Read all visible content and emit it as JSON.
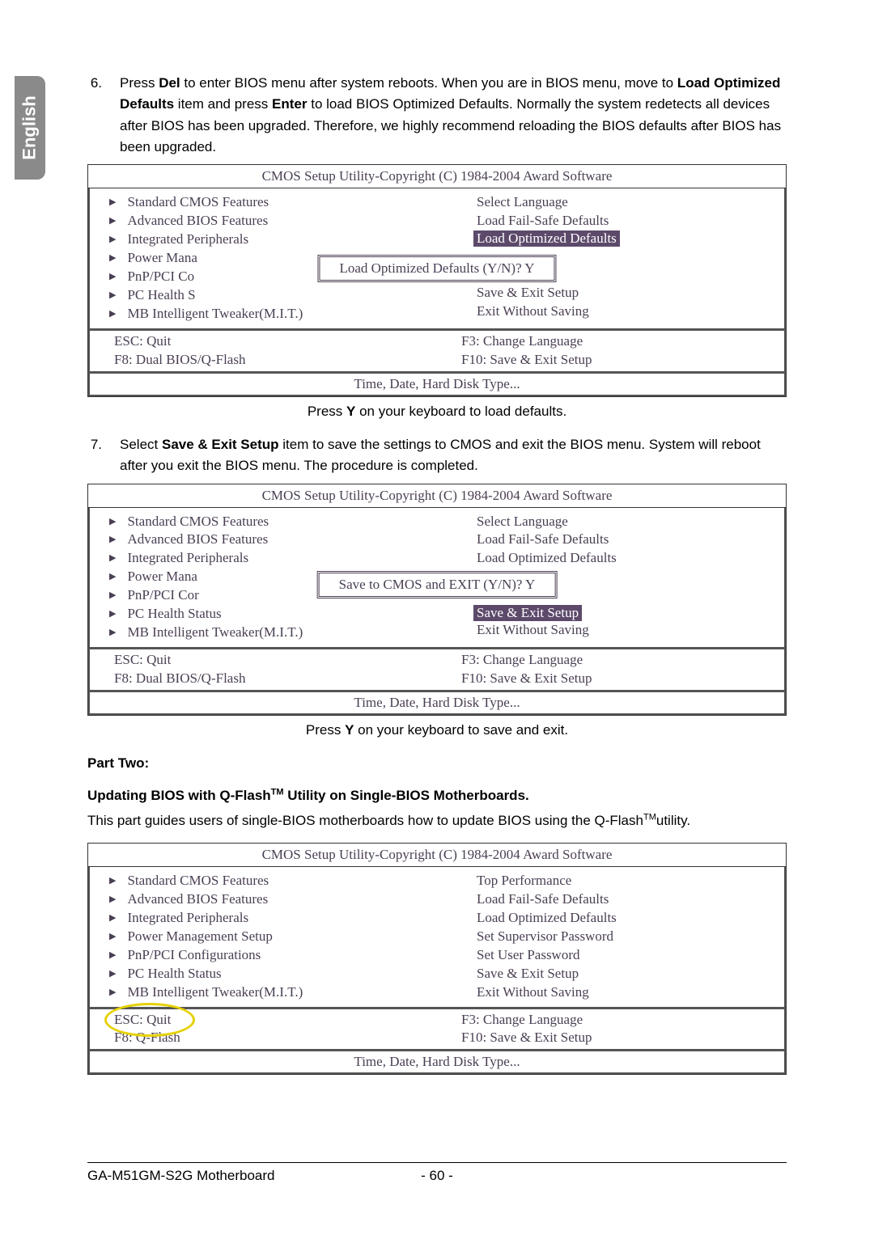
{
  "side_tab": "English",
  "steps": {
    "s6": {
      "num": "6.",
      "parts": [
        "Press ",
        "Del",
        " to enter BIOS menu after system reboots. When you are in BIOS menu, move to ",
        "Load Optimized Defaults",
        " item and press ",
        "Enter",
        " to load BIOS Optimized Defaults. Normally the system redetects all devices after BIOS has been upgraded. Therefore, we highly recommend reloading the BIOS defaults after BIOS has been upgraded."
      ]
    },
    "s7": {
      "num": "7.",
      "parts": [
        "Select ",
        "Save & Exit Setup",
        " item to save the settings to CMOS and exit the BIOS menu. System will reboot after you exit the BIOS menu. The procedure is completed."
      ]
    }
  },
  "captions": {
    "c1_pre": "Press ",
    "c1_b": "Y",
    "c1_post": " on your keyboard to load defaults.",
    "c2_pre": "Press ",
    "c2_b": "Y",
    "c2_post": " on your keyboard to save and exit."
  },
  "bios_common": {
    "title": "CMOS Setup Utility-Copyright (C) 1984-2004 Award Software",
    "left_items": [
      "Standard CMOS Features",
      "Advanced BIOS Features",
      "Integrated Peripherals",
      "Power Management Setup",
      "PnP/PCI Configurations",
      "PC Health Status",
      "MB Intelligent Tweaker(M.I.T.)"
    ],
    "hint": "Time, Date, Hard Disk Type..."
  },
  "bios1": {
    "left_partial": [
      "Standard CMOS Features",
      "Advanced BIOS Features",
      "Integrated Peripherals",
      "Power Mana",
      "PnP/PCI Co",
      "PC Health S",
      "MB Intelligent Tweaker(M.I.T.)"
    ],
    "right": [
      "Select Language",
      "Load Fail-Safe Defaults"
    ],
    "highlight": "Load Optimized Defaults",
    "right_after": [
      "Save & Exit Setup",
      "Exit Without Saving"
    ],
    "dialog": "Load Optimized Defaults (Y/N)? Y",
    "foot": {
      "l1": "ESC: Quit",
      "l2": "F8: Dual BIOS/Q-Flash",
      "r1": "F3: Change Language",
      "r2": "F10: Save & Exit Setup"
    }
  },
  "bios2": {
    "left_partial": [
      "Standard CMOS Features",
      "Advanced BIOS Features",
      "Integrated Peripherals",
      "Power Mana",
      "PnP/PCI Cor",
      "PC Health Status",
      "MB Intelligent Tweaker(M.I.T.)"
    ],
    "right": [
      "Select Language",
      "Load Fail-Safe Defaults",
      "Load Optimized Defaults"
    ],
    "highlight": "Save & Exit Setup",
    "right_after": [
      "Exit Without Saving"
    ],
    "dialog": "Save to CMOS and EXIT (Y/N)? Y",
    "foot": {
      "l1": "ESC: Quit",
      "l2": "F8: Dual BIOS/Q-Flash",
      "r1": "F3: Change Language",
      "r2": "F10: Save & Exit Setup"
    }
  },
  "bios3": {
    "right": [
      "Top Performance",
      "Load Fail-Safe Defaults",
      "Load Optimized Defaults",
      "Set Supervisor Password",
      "Set User Password",
      "Save & Exit Setup",
      "Exit Without Saving"
    ],
    "foot": {
      "l1": "ESC: Quit",
      "l2": "F8: Q-Flash",
      "r1": "F3: Change Language",
      "r2": "F10: Save & Exit Setup"
    }
  },
  "part_two": {
    "label": "Part Two:",
    "heading_pre": "Updating BIOS with Q-Flash",
    "heading_tm": "TM",
    "heading_post": " Utility on Single-BIOS Motherboards.",
    "body_pre": "This part guides users of single-BIOS motherboards how to update BIOS using the Q-Flash",
    "body_tm": "TM",
    "body_post": "utility."
  },
  "footer": {
    "left": "GA-M51GM-S2G Motherboard",
    "center": "- 60 -"
  }
}
